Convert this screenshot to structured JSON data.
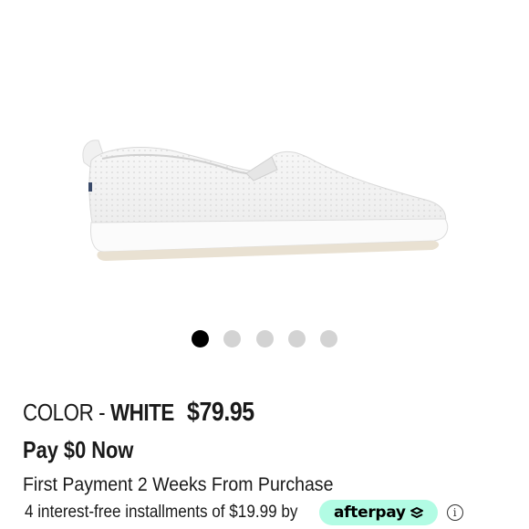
{
  "product": {
    "image_alt": "White perforated slip-on sneaker",
    "color_label": "COLOR - ",
    "color_value": "WHITE",
    "price": "$79.95"
  },
  "carousel": {
    "total_slides": 5,
    "active_index": 0
  },
  "payment": {
    "pay_now": "Pay $0 Now",
    "first_payment": "First Payment 2 Weeks From Purchase",
    "installments": "4 interest-free installments of $19.99 by",
    "provider_label": "afterpay",
    "provider_icon": "afterpay-arrows-icon",
    "provider_color": "#b2fce4",
    "info_icon": "info-icon"
  }
}
